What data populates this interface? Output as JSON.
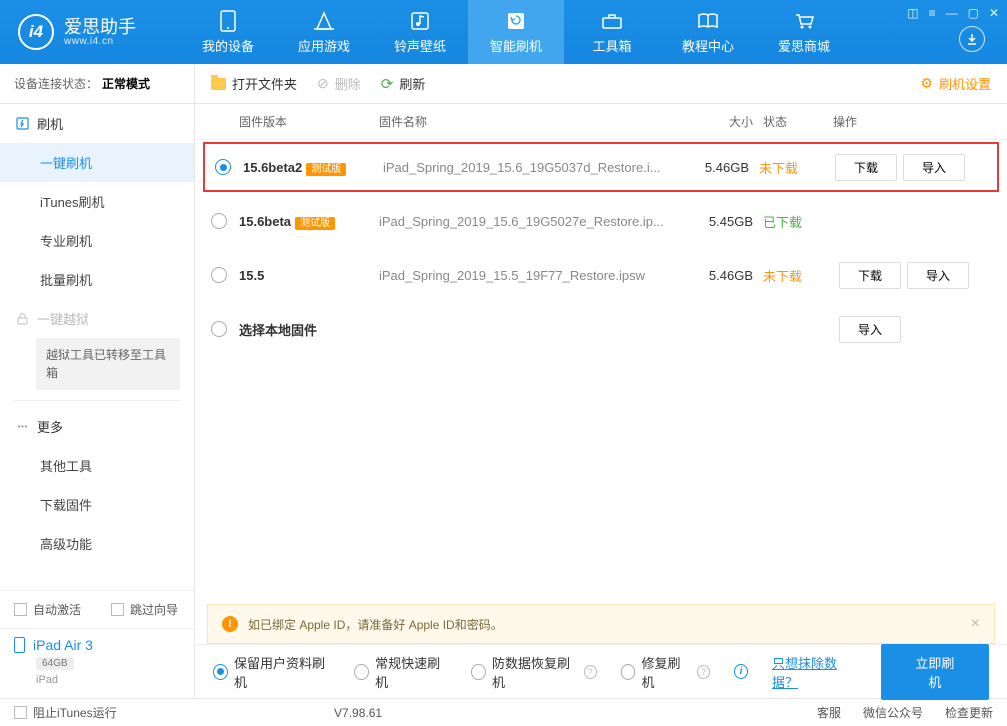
{
  "app": {
    "name_cn": "爱思助手",
    "name_en": "www.i4.cn"
  },
  "nav": {
    "items": [
      {
        "label": "我的设备"
      },
      {
        "label": "应用游戏"
      },
      {
        "label": "铃声壁纸"
      },
      {
        "label": "智能刷机"
      },
      {
        "label": "工具箱"
      },
      {
        "label": "教程中心"
      },
      {
        "label": "爱思商城"
      }
    ]
  },
  "status": {
    "prefix": "设备连接状态：",
    "mode": "正常模式"
  },
  "sidebar": {
    "flash_group": "刷机",
    "items": [
      "一键刷机",
      "iTunes刷机",
      "专业刷机",
      "批量刷机"
    ],
    "jailbreak": "一键越狱",
    "jailbreak_note": "越狱工具已转移至工具箱",
    "more": "更多",
    "more_items": [
      "其他工具",
      "下载固件",
      "高级功能"
    ],
    "auto_activate": "自动激活",
    "skip_guide": "跳过向导",
    "device": {
      "name": "iPad Air 3",
      "storage": "64GB",
      "type": "iPad"
    }
  },
  "toolbar": {
    "open_folder": "打开文件夹",
    "delete": "删除",
    "refresh": "刷新",
    "settings": "刷机设置"
  },
  "table": {
    "headers": {
      "version": "固件版本",
      "name": "固件名称",
      "size": "大小",
      "state": "状态",
      "ops": "操作"
    },
    "rows": [
      {
        "version": "15.6beta2",
        "beta": "测试版",
        "name": "iPad_Spring_2019_15.6_19G5037d_Restore.i...",
        "size": "5.46GB",
        "state": "未下载",
        "state_cls": "orange",
        "selected": true,
        "ops": [
          "下载",
          "导入"
        ]
      },
      {
        "version": "15.6beta",
        "beta": "测试版",
        "name": "iPad_Spring_2019_15.6_19G5027e_Restore.ip...",
        "size": "5.45GB",
        "state": "已下载",
        "state_cls": "green",
        "selected": false,
        "ops": []
      },
      {
        "version": "15.5",
        "beta": "",
        "name": "iPad_Spring_2019_15.5_19F77_Restore.ipsw",
        "size": "5.46GB",
        "state": "未下载",
        "state_cls": "orange",
        "selected": false,
        "ops": [
          "下载",
          "导入"
        ]
      },
      {
        "version": "选择本地固件",
        "beta": "",
        "name": "",
        "size": "",
        "state": "",
        "state_cls": "",
        "selected": false,
        "ops": [
          "导入"
        ]
      }
    ]
  },
  "alert": "如已绑定 Apple ID，请准备好 Apple ID和密码。",
  "actions": {
    "opts": [
      "保留用户资料刷机",
      "常规快速刷机",
      "防数据恢复刷机",
      "修复刷机"
    ],
    "erase_link": "只想抹除数据？",
    "flash_btn": "立即刷机"
  },
  "footer": {
    "block_itunes": "阻止iTunes运行",
    "version": "V7.98.61",
    "links": [
      "客服",
      "微信公众号",
      "检查更新"
    ]
  }
}
